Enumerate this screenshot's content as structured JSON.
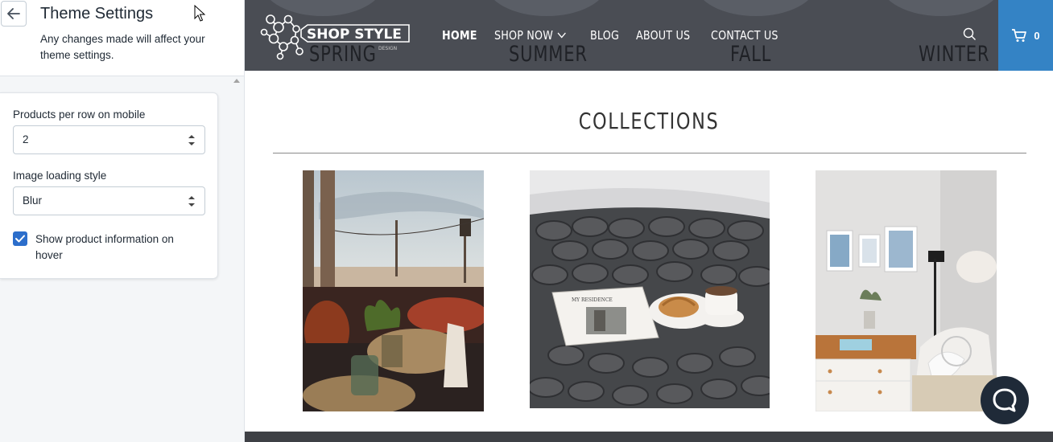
{
  "editor": {
    "title": "Theme Settings",
    "description": "Any changes made will affect your theme settings.",
    "fields": {
      "products_per_row_label": "Products per row on mobile",
      "products_per_row_value": "2",
      "image_loading_label": "Image loading style",
      "image_loading_value": "Blur",
      "show_info_label": "Show product information on hover",
      "show_info_checked": true
    }
  },
  "store": {
    "logo_text": "SHOP STYLE",
    "logo_subtext": "DESIGN",
    "hero_words": [
      "SPRING",
      "SUMMER",
      "FALL",
      "WINTER"
    ],
    "nav": [
      {
        "label": "HOME",
        "active": true
      },
      {
        "label": "SHOP NOW",
        "dropdown": true
      },
      {
        "label": "BLOG"
      },
      {
        "label": "ABOUT US"
      },
      {
        "label": "CONTACT US"
      }
    ],
    "cart_count": "0",
    "section_title": "COLLECTIONS",
    "book_title": "MY RESIDENCE"
  },
  "colors": {
    "accent": "#3483c5",
    "header_bg": "#4a4d54",
    "checkbox": "#2c6ecb"
  },
  "icons": [
    "back-arrow-icon",
    "chevron-down-icon",
    "search-icon",
    "cart-icon",
    "chat-icon",
    "check-icon"
  ]
}
